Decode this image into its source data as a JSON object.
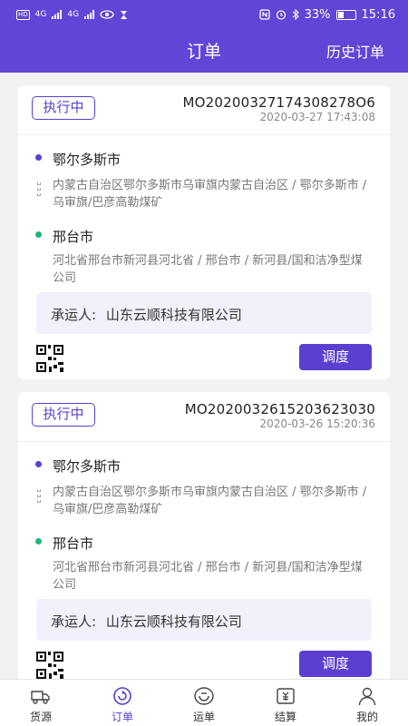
{
  "status_bar": {
    "left_labels": [
      "HD",
      "4G",
      "4G"
    ],
    "battery": "33%",
    "time": "15:16"
  },
  "header": {
    "title": "订单",
    "history": "历史订单"
  },
  "orders": [
    {
      "status": "执行中",
      "order_no": "MO20200327174308278O6",
      "time": "2020-03-27 17:43:08",
      "from_city": "鄂尔多斯市",
      "from_address": "内蒙古自治区鄂尔多斯市乌审旗内蒙古自治区 / 鄂尔多斯市 / 乌审旗/巴彦高勒煤矿",
      "to_city": "邢台市",
      "to_address": "河北省邢台市新河县河北省 / 邢台市 / 新河县/国和洁净型煤公司",
      "carrier_label": "承运人:",
      "carrier_name": "山东云顺科技有限公司",
      "action": "调度"
    },
    {
      "status": "执行中",
      "order_no": "MO2020032615203623030",
      "time": "2020-03-26 15:20:36",
      "from_city": "鄂尔多斯市",
      "from_address": "内蒙古自治区鄂尔多斯市乌审旗内蒙古自治区 / 鄂尔多斯市 / 乌审旗/巴彦高勒煤矿",
      "to_city": "邢台市",
      "to_address": "河北省邢台市新河县河北省 / 邢台市 / 新河县/国和洁净型煤公司",
      "carrier_label": "承运人:",
      "carrier_name": "山东云顺科技有限公司",
      "action": "调度"
    }
  ],
  "tabs": [
    {
      "label": "货源",
      "icon": "truck-icon"
    },
    {
      "label": "订单",
      "icon": "order-icon",
      "active": true
    },
    {
      "label": "运单",
      "icon": "waybill-icon"
    },
    {
      "label": "结算",
      "icon": "settlement-icon"
    },
    {
      "label": "我的",
      "icon": "profile-icon"
    }
  ],
  "colors": {
    "brand": "#6145d6",
    "accent": "#5a3fd0",
    "origin_dot": "#5a3fd0",
    "destination_dot": "#1db877"
  }
}
